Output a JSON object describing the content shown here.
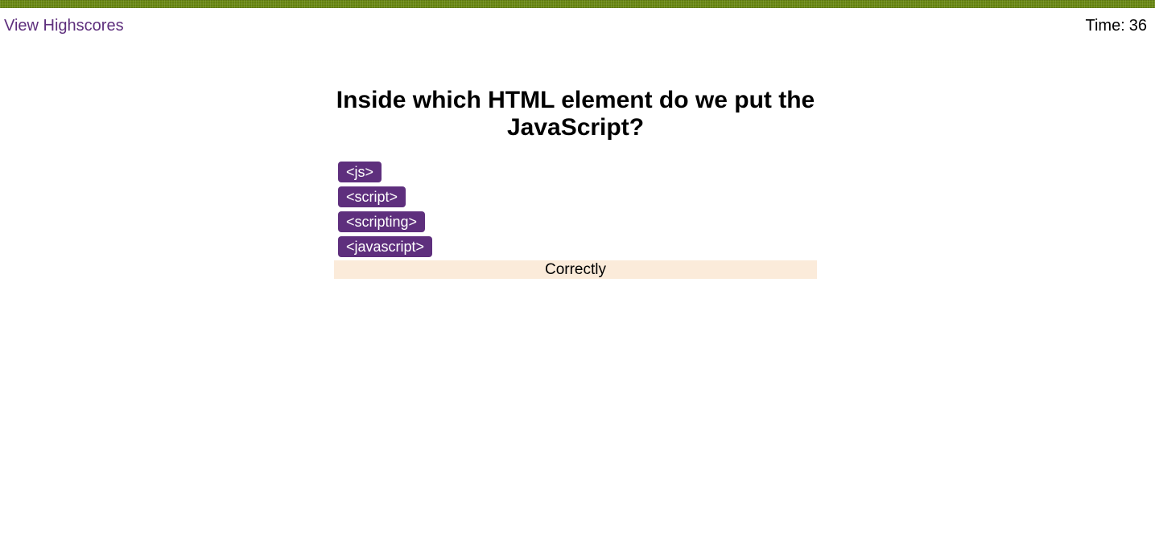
{
  "header": {
    "highscores_link": "View Highscores",
    "timer_label": "Time:",
    "timer_value": "36"
  },
  "quiz": {
    "question": "Inside which HTML element do we put the JavaScript?",
    "choices": [
      {
        "label": "<js>"
      },
      {
        "label": "<script>"
      },
      {
        "label": "<scripting>"
      },
      {
        "label": "<javascript>"
      }
    ],
    "feedback": "Correctly"
  },
  "colors": {
    "accent": "#5e2f7d",
    "feedback_bg": "#fbebda",
    "top_strip": "#6b8a14"
  }
}
